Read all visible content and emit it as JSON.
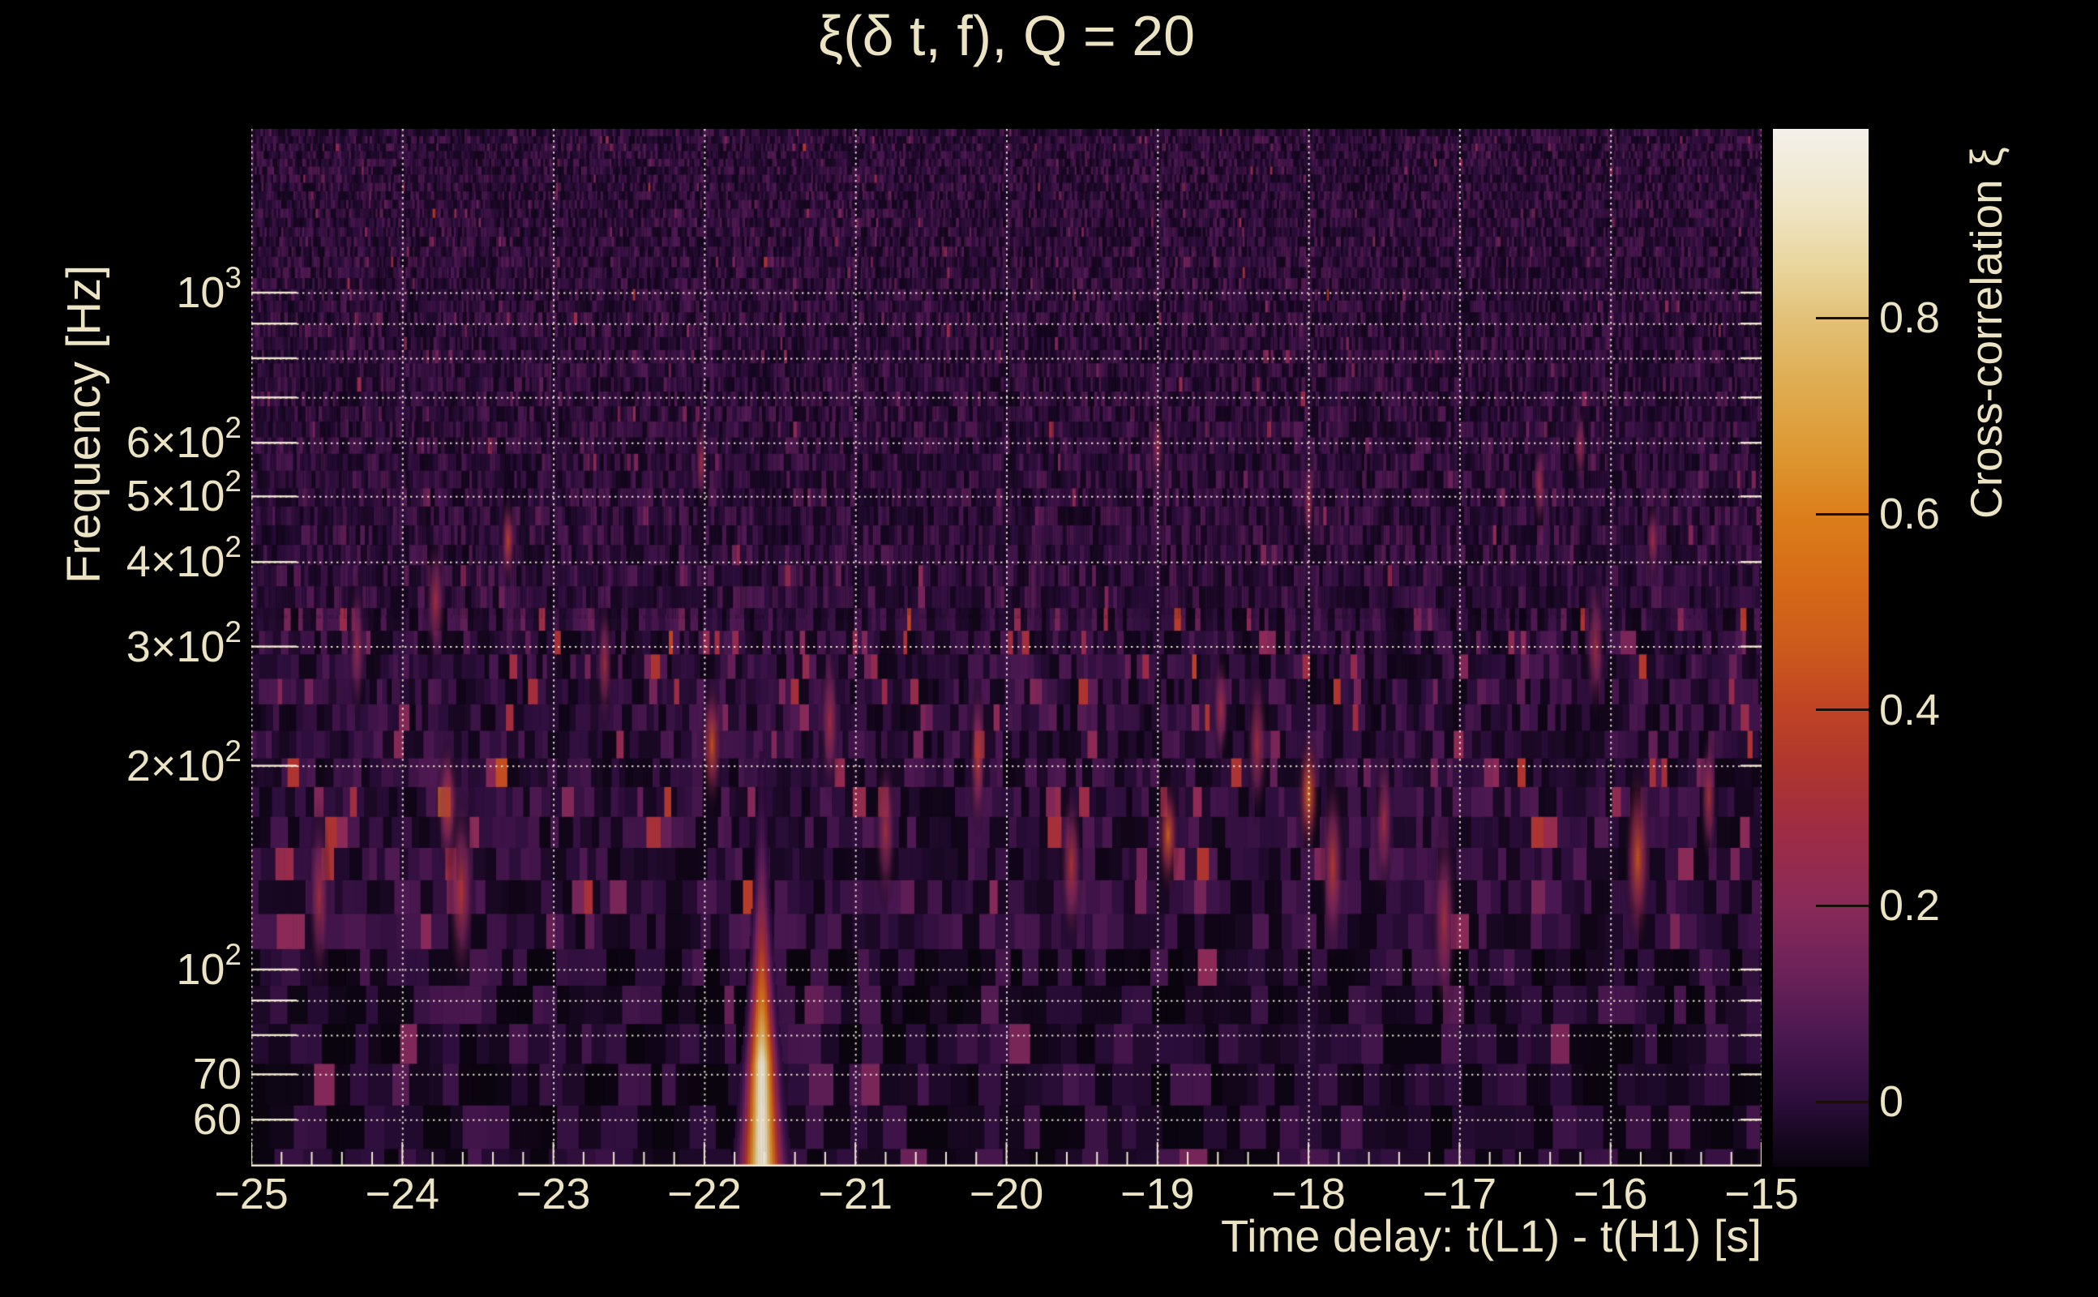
{
  "figure": {
    "background": "#000000",
    "text_color": "#ece3c3",
    "grid_color": "#f3ecd6"
  },
  "chart_data": {
    "type": "heatmap",
    "title": "ξ(δ t, f), Q = 20",
    "xlabel": "Time delay: t(L1) - t(H1) [s]",
    "ylabel": "Frequency [Hz]",
    "y_scale": "log",
    "grid": "dotted",
    "x_range": [
      -25,
      -15
    ],
    "y_range_hz": [
      52,
      1746
    ],
    "x_minor_tick_step_s": 0.2,
    "x_ticks": [
      {
        "value": -25,
        "label": "−25"
      },
      {
        "value": -24,
        "label": "−24"
      },
      {
        "value": -23,
        "label": "−23"
      },
      {
        "value": -22,
        "label": "−22"
      },
      {
        "value": -21,
        "label": "−21"
      },
      {
        "value": -20,
        "label": "−20"
      },
      {
        "value": -19,
        "label": "−19"
      },
      {
        "value": -18,
        "label": "−18"
      },
      {
        "value": -17,
        "label": "−17"
      },
      {
        "value": -16,
        "label": "−16"
      },
      {
        "value": -15,
        "label": "−15"
      }
    ],
    "y_ticks": [
      {
        "value": 1000,
        "mantissa": "10",
        "exponent": "3"
      },
      {
        "value": 600,
        "mantissa": "6×10",
        "exponent": "2"
      },
      {
        "value": 500,
        "mantissa": "5×10",
        "exponent": "2"
      },
      {
        "value": 400,
        "mantissa": "4×10",
        "exponent": "2"
      },
      {
        "value": 300,
        "mantissa": "3×10",
        "exponent": "2"
      },
      {
        "value": 200,
        "mantissa": "2×10",
        "exponent": "2"
      },
      {
        "value": 100,
        "mantissa": "10",
        "exponent": "2"
      },
      {
        "value": 70,
        "mantissa": "70",
        "exponent": ""
      },
      {
        "value": 60,
        "mantissa": "60",
        "exponent": ""
      }
    ],
    "y_gridlines_hz": [
      60,
      70,
      80,
      90,
      100,
      200,
      300,
      400,
      500,
      600,
      700,
      800,
      900,
      1000
    ],
    "colorbar": {
      "label": "Cross-correlation ξ",
      "value_range": [
        -0.066,
        0.993
      ],
      "ticks": [
        {
          "value": 0.8,
          "label": "0.8"
        },
        {
          "value": 0.6,
          "label": "0.6"
        },
        {
          "value": 0.4,
          "label": "0.4"
        },
        {
          "value": 0.2,
          "label": "0.2"
        },
        {
          "value": 0.0,
          "label": "0"
        }
      ],
      "gradient_stops": [
        {
          "pos": 0.0,
          "color": "#f3f0ea"
        },
        {
          "pos": 0.071,
          "color": "#efe6c8"
        },
        {
          "pos": 0.134,
          "color": "#e9d59b"
        },
        {
          "pos": 0.182,
          "color": "#e2c178"
        },
        {
          "pos": 0.243,
          "color": "#dfad52"
        },
        {
          "pos": 0.313,
          "color": "#dd9732"
        },
        {
          "pos": 0.37,
          "color": "#db7f1b"
        },
        {
          "pos": 0.438,
          "color": "#d56a17"
        },
        {
          "pos": 0.501,
          "color": "#cc5a1d"
        },
        {
          "pos": 0.558,
          "color": "#c04424"
        },
        {
          "pos": 0.618,
          "color": "#ae3530"
        },
        {
          "pos": 0.68,
          "color": "#9d2c46"
        },
        {
          "pos": 0.748,
          "color": "#8a2a58"
        },
        {
          "pos": 0.813,
          "color": "#6b2259"
        },
        {
          "pos": 0.876,
          "color": "#4a1850"
        },
        {
          "pos": 0.937,
          "color": "#2c0e3b"
        },
        {
          "pos": 0.97,
          "color": "#180822"
        },
        {
          "pos": 1.0,
          "color": "#0a040f"
        }
      ]
    },
    "main_feature": {
      "description": "Bright vertical cross-correlation streak (candidate signal)",
      "time_delay_s": -21.62,
      "freq_span_hz": [
        52,
        210
      ],
      "peak": 0.99
    },
    "hotspots": [
      {
        "dt": -24.55,
        "f": 128,
        "v": 0.3
      },
      {
        "dt": -24.3,
        "f": 300,
        "v": 0.26
      },
      {
        "dt": -23.78,
        "f": 350,
        "v": 0.3
      },
      {
        "dt": -23.7,
        "f": 175,
        "v": 0.38
      },
      {
        "dt": -23.61,
        "f": 131,
        "v": 0.34
      },
      {
        "dt": -23.3,
        "f": 430,
        "v": 0.4
      },
      {
        "dt": -22.66,
        "f": 283,
        "v": 0.3
      },
      {
        "dt": -22.02,
        "f": 560,
        "v": 0.3
      },
      {
        "dt": -21.95,
        "f": 215,
        "v": 0.45
      },
      {
        "dt": -21.17,
        "f": 232,
        "v": 0.3
      },
      {
        "dt": -20.8,
        "f": 160,
        "v": 0.3
      },
      {
        "dt": -20.19,
        "f": 205,
        "v": 0.36
      },
      {
        "dt": -19.57,
        "f": 143,
        "v": 0.34
      },
      {
        "dt": -19.0,
        "f": 592,
        "v": 0.28
      },
      {
        "dt": -18.93,
        "f": 158,
        "v": 0.5
      },
      {
        "dt": -18.58,
        "f": 243,
        "v": 0.3
      },
      {
        "dt": -18.34,
        "f": 215,
        "v": 0.3
      },
      {
        "dt": -18.0,
        "f": 182,
        "v": 0.55
      },
      {
        "dt": -18.0,
        "f": 490,
        "v": 0.3
      },
      {
        "dt": -17.84,
        "f": 142,
        "v": 0.36
      },
      {
        "dt": -17.5,
        "f": 165,
        "v": 0.3
      },
      {
        "dt": -17.1,
        "f": 118,
        "v": 0.3
      },
      {
        "dt": -16.47,
        "f": 520,
        "v": 0.3
      },
      {
        "dt": -16.2,
        "f": 592,
        "v": 0.28
      },
      {
        "dt": -16.1,
        "f": 300,
        "v": 0.28
      },
      {
        "dt": -15.82,
        "f": 146,
        "v": 0.45
      },
      {
        "dt": -15.72,
        "f": 430,
        "v": 0.3
      },
      {
        "dt": -15.35,
        "f": 180,
        "v": 0.33
      }
    ],
    "noise": {
      "seed": 1337,
      "high_amp": 0.16,
      "mid_amp": 0.36,
      "low_amp": 0.24,
      "mid_band_hz": [
        110,
        360
      ],
      "spike_prob_high": 0.05,
      "spike_prob_mid": 0.13,
      "spike_prob_low": 0.06
    }
  }
}
